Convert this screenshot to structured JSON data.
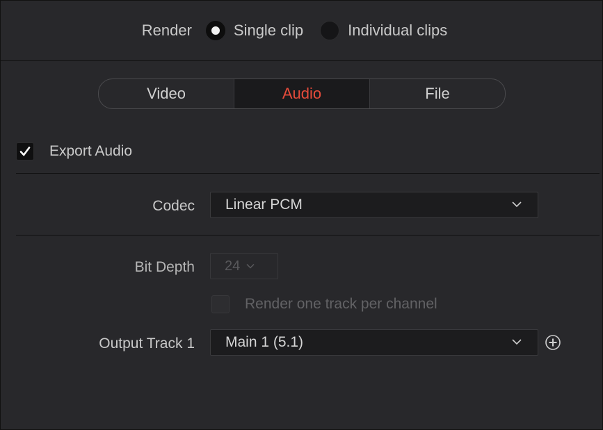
{
  "render_mode": {
    "label": "Render",
    "options": [
      {
        "label": "Single clip",
        "selected": true
      },
      {
        "label": "Individual clips",
        "selected": false
      }
    ]
  },
  "tabs": [
    {
      "label": "Video",
      "active": false
    },
    {
      "label": "Audio",
      "active": true
    },
    {
      "label": "File",
      "active": false
    }
  ],
  "export_audio": {
    "label": "Export Audio",
    "checked": true
  },
  "codec": {
    "label": "Codec",
    "value": "Linear PCM"
  },
  "bit_depth": {
    "label": "Bit Depth",
    "value": "24",
    "enabled": false
  },
  "render_one_track": {
    "label": "Render one track per channel",
    "checked": false,
    "enabled": false
  },
  "output_track": {
    "label": "Output Track 1",
    "value": "Main 1 (5.1)"
  },
  "colors": {
    "accent": "#e64b3b",
    "background": "#28282b",
    "field": "#1c1c1e"
  }
}
